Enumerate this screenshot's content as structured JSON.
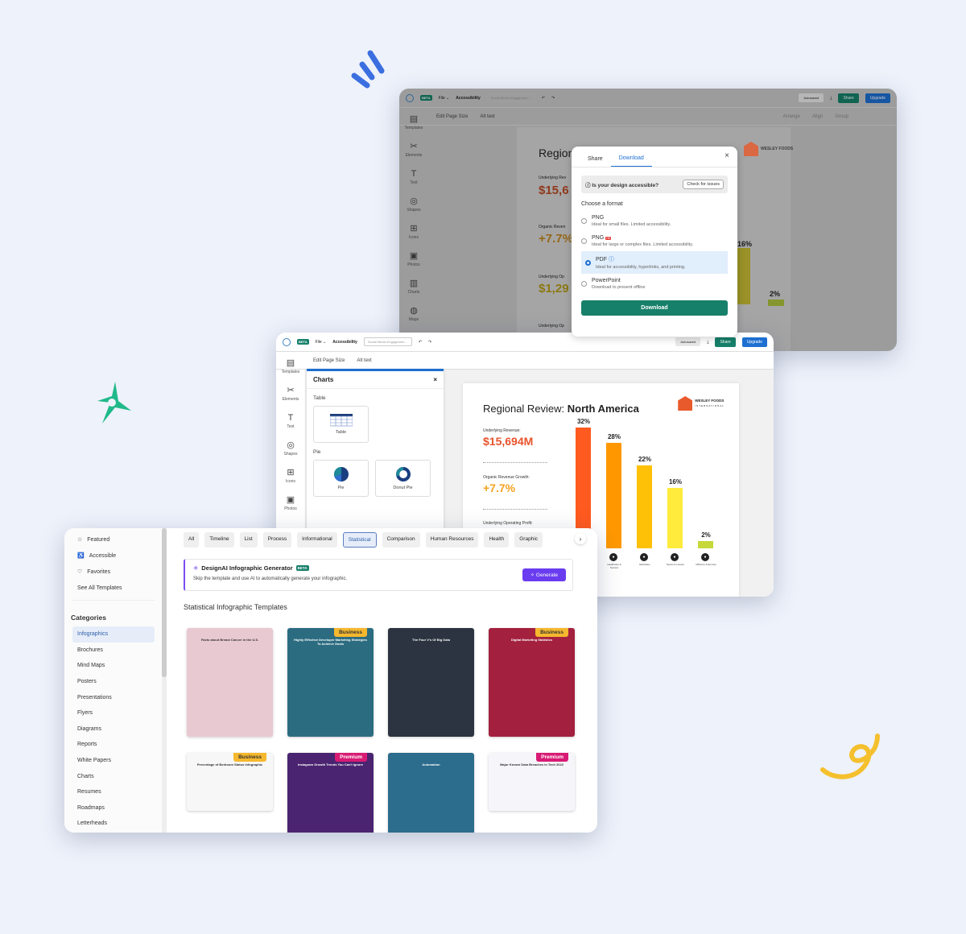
{
  "decorations": {
    "colors": {
      "blue_marks": "#3b6fe0",
      "green_star": "#1fb98a",
      "yellow_swirl": "#f5c02e"
    }
  },
  "back_window": {
    "topbar": {
      "beta": "BETA",
      "file": "File ⌄",
      "accessibility": "Accessibility",
      "doc_name": "Social Media Engagemen...",
      "undo": "↶",
      "redo": "↷",
      "autosaved": "Autosaved",
      "share": "Share",
      "upgrade": "Upgrade"
    },
    "subbar": {
      "edit_page_size": "Edit Page Size",
      "alt_text": "Alt text",
      "arrange": "Arrange",
      "align": "Align",
      "group": "Group"
    },
    "rail": [
      {
        "icon": "▤",
        "label": "Templates"
      },
      {
        "icon": "✂",
        "label": "Elements"
      },
      {
        "icon": "T",
        "label": "Text"
      },
      {
        "icon": "◎",
        "label": "Shapes"
      },
      {
        "icon": "⊞",
        "label": "Icons"
      },
      {
        "icon": "▣",
        "label": "Photos"
      },
      {
        "icon": "▥",
        "label": "Charts"
      },
      {
        "icon": "◍",
        "label": "Maps"
      }
    ],
    "canvas": {
      "title": "Region",
      "stats": [
        {
          "label": "Underlying Rev",
          "value": "$15,6"
        },
        {
          "label": "Organic Reven",
          "value": "+7.7%"
        },
        {
          "label": "Underlying Op",
          "value": "$1,29"
        },
        {
          "label": "Underlying Op",
          "value": ""
        }
      ],
      "bar_labels": [
        "16%",
        "2%"
      ],
      "cats": [
        "Sports & Leisure",
        "Offshore & Remote"
      ]
    },
    "modal": {
      "tabs": [
        "Share",
        "Download"
      ],
      "active_tab": "Download",
      "close": "×",
      "accessible_q": "Is your design accessible?",
      "check_btn": "Check for issues",
      "choose_format": "Choose a format",
      "options": [
        {
          "title": "PNG",
          "desc": "Ideal for small files. Limited accessibility.",
          "selected": false,
          "hd": false
        },
        {
          "title": "PNG",
          "desc": "Ideal for large or complex files. Limited accessibility.",
          "selected": false,
          "hd": true
        },
        {
          "title": "PDF",
          "desc": "Ideal for accessibility, hyperlinks, and printing.",
          "selected": true,
          "hd": false
        },
        {
          "title": "PowerPoint",
          "desc": "Download to present offline",
          "selected": false,
          "hd": false
        }
      ],
      "hd_badge": "HD",
      "download_btn": "Download"
    }
  },
  "middle_window": {
    "topbar": {
      "beta": "BETA",
      "file": "File ⌄",
      "accessibility": "Accessibility",
      "doc_name": "Social Media Engagemen...",
      "undo": "↶",
      "redo": "↷",
      "autosaved": "Autosaved",
      "share": "Share",
      "upgrade": "Upgrade"
    },
    "subbar": {
      "edit_page_size": "Edit Page Size",
      "alt_text": "Alt text"
    },
    "rail": [
      {
        "icon": "▤",
        "label": "Templates"
      },
      {
        "icon": "✂",
        "label": "Elements"
      },
      {
        "icon": "T",
        "label": "Text"
      },
      {
        "icon": "◎",
        "label": "Shapes"
      },
      {
        "icon": "⊞",
        "label": "Icons"
      },
      {
        "icon": "▣",
        "label": "Photos"
      }
    ],
    "charts_panel": {
      "title": "Charts",
      "close": "×",
      "section_table": "Table",
      "table_card": "Table",
      "section_pie": "Pie",
      "pie_card": "Pie",
      "donut_card": "Donut Pie"
    },
    "canvas": {
      "title_light": "Regional Review: ",
      "title_bold": "North America",
      "brand": "WESLEY FOODS",
      "brand_sub": "INTERNATIONAL",
      "stats": [
        {
          "label": "Underlying Revenue:",
          "value": "$15,694M",
          "color": "#e8532b"
        },
        {
          "label": "Organic Revenue Growth:",
          "value": "+7.7%",
          "color": "#f5a21e"
        },
        {
          "label": "Underlying Operating Profit:",
          "value": "",
          "color": "#e0b21a"
        }
      ]
    }
  },
  "chart_data": {
    "type": "bar",
    "title": "Regional Review: North America",
    "categories": [
      "",
      "Healthcare & Seniors",
      "Education",
      "Sports & Leisure",
      "Offshore & Remote"
    ],
    "values": [
      32,
      28,
      22,
      16,
      2
    ],
    "unit": "%",
    "colors": [
      "#ff5a1f",
      "#ff9800",
      "#ffc107",
      "#ffeb3b",
      "#c6d83a"
    ],
    "ylim": [
      0,
      32
    ]
  },
  "front_window": {
    "side_top": [
      {
        "icon": "☆",
        "label": "Featured"
      },
      {
        "icon": "♿",
        "label": "Accessible"
      },
      {
        "icon": "♡",
        "label": "Favorites"
      },
      {
        "icon": "",
        "label": "See All Templates"
      }
    ],
    "categories_header": "Categories",
    "categories": [
      "Infographics",
      "Brochures",
      "Mind Maps",
      "Posters",
      "Presentations",
      "Flyers",
      "Diagrams",
      "Reports",
      "White Papers",
      "Charts",
      "Resumes",
      "Roadmaps",
      "Letterheads"
    ],
    "active_category": "Infographics",
    "chips": [
      "All",
      "Timeline",
      "List",
      "Process",
      "Informational",
      "Statistical",
      "Comparison",
      "Human Resources",
      "Health",
      "Graphic"
    ],
    "active_chip": "Statistical",
    "chev": "›",
    "ai": {
      "title": "DesignAI Infographic Generator",
      "beta": "BETA",
      "desc": "Skip the template and use AI to automatically generate your infographic.",
      "generate": "Generate"
    },
    "section_title": "Statistical Infographic Templates",
    "templates": [
      {
        "name": "Facts about Breast Cancer in the U.S.",
        "badge": "",
        "bg": "#e8c9d2"
      },
      {
        "name": "Highly Effective Developer Marketing Strategies To Achieve Goals",
        "badge": "Business",
        "bg": "#2c6c80"
      },
      {
        "name": "The Four V's Of Big Data",
        "badge": "",
        "bg": "#2b3440"
      },
      {
        "name": "Digital Marketing Statistics",
        "badge": "Business",
        "bg": "#a3213e"
      },
      {
        "name": "Percentage of Bedroom Status Infographic",
        "badge": "Business",
        "bg": "#f7f7f7"
      },
      {
        "name": "Instagram Growth Trends You Can't Ignore",
        "badge": "Premium",
        "bg": "#4a2470"
      },
      {
        "name": "Automation",
        "badge": "",
        "bg": "#2c6c8c"
      },
      {
        "name": "Major Known Data Breaches in Tech 2022",
        "badge": "Premium",
        "bg": "#f6f6fa"
      }
    ]
  }
}
